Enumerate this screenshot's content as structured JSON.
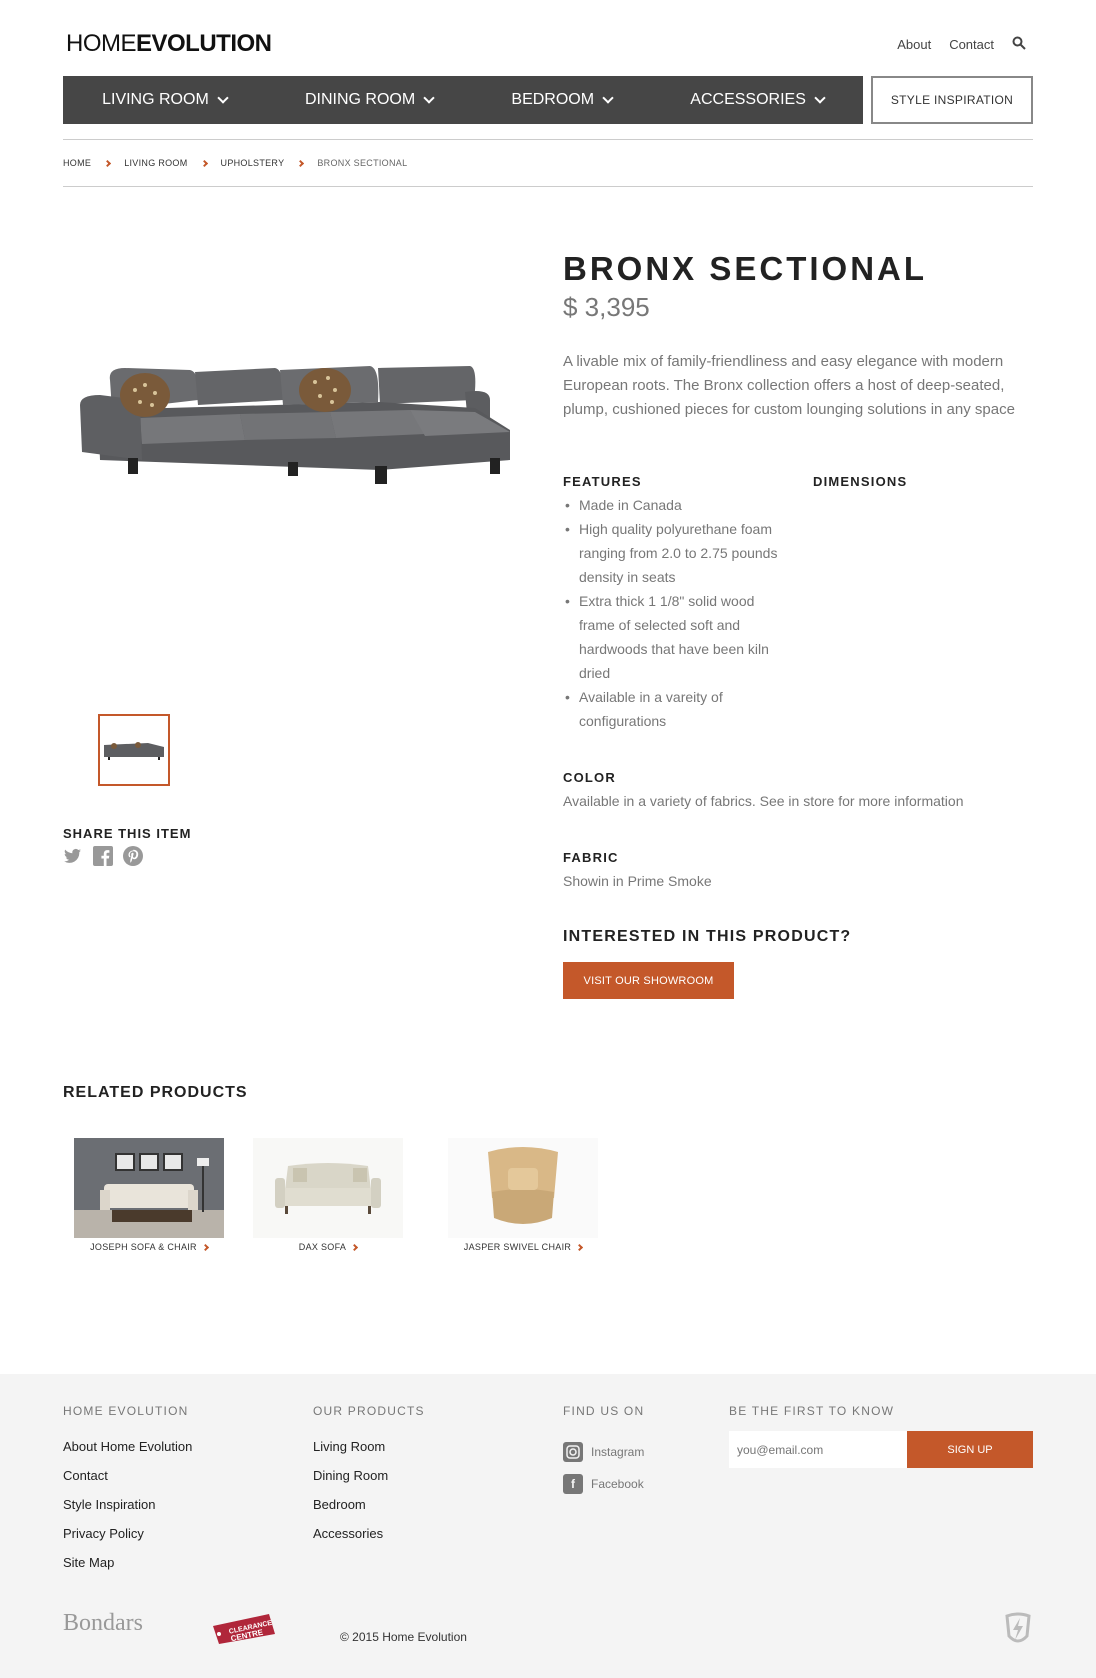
{
  "brand": {
    "thin": "HOME",
    "bold": "EVOLUTION"
  },
  "top_links": {
    "about": "About",
    "contact": "Contact"
  },
  "nav": {
    "items": [
      {
        "label": "LIVING ROOM"
      },
      {
        "label": "DINING ROOM"
      },
      {
        "label": "BEDROOM"
      },
      {
        "label": "ACCESSORIES"
      }
    ],
    "style_inspiration": "STYLE INSPIRATION"
  },
  "breadcrumb": [
    "HOME",
    "LIVING ROOM",
    "UPHOLSTERY",
    "BRONX SECTIONAL"
  ],
  "product": {
    "title": "BRONX SECTIONAL",
    "price": "$ 3,395",
    "description": "A livable mix of family-friendliness and easy elegance with modern European roots.  The Bronx collection offers a host of deep-seated, plump, cushioned pieces for custom lounging solutions in any space",
    "features_title": "FEATURES",
    "features": [
      "Made in Canada",
      "High quality polyurethane foam ranging from 2.0 to 2.75 pounds density in seats",
      "Extra thick 1 1/8\" solid wood frame of selected soft and hardwoods that have been kiln dried",
      "Available in a vareity of configurations"
    ],
    "dimensions_title": "DIMENSIONS",
    "color_title": "COLOR",
    "color_text": "Available in a variety of fabrics. See in store for more information",
    "fabric_title": "FABRIC",
    "fabric_text": "Showin in Prime Smoke",
    "interest_title": "INTERESTED IN THIS PRODUCT?",
    "cta": "VISIT OUR SHOWROOM"
  },
  "share": {
    "title": "SHARE THIS ITEM",
    "icons": [
      "twitter-icon",
      "facebook-icon",
      "pinterest-icon"
    ]
  },
  "related": {
    "title": "RELATED PRODUCTS",
    "items": [
      {
        "label": "JOSEPH SOFA & CHAIR"
      },
      {
        "label": "DAX SOFA"
      },
      {
        "label": "JASPER SWIVEL CHAIR"
      }
    ]
  },
  "footer": {
    "col1": {
      "title": "HOME EVOLUTION",
      "links": [
        "About Home Evolution",
        "Contact",
        "Style Inspiration",
        "Privacy Policy",
        "Site Map"
      ]
    },
    "col2": {
      "title": "OUR PRODUCTS",
      "links": [
        "Living Room",
        "Dining Room",
        "Bedroom",
        "Accessories"
      ]
    },
    "col3": {
      "title": "FIND US ON",
      "links": [
        "Instagram",
        "Facebook"
      ]
    },
    "col4": {
      "title": "BE THE FIRST TO KNOW",
      "placeholder": "you@email.com",
      "button": "SIGN UP"
    },
    "bondars": "Bondars",
    "clearance_text": "CLEARANCE CENTRE",
    "copyright": "© 2015 Home Evolution"
  },
  "colors": {
    "accent": "#c4582a",
    "nav_bg": "#464646",
    "footer_bg": "#f4f4f4"
  }
}
